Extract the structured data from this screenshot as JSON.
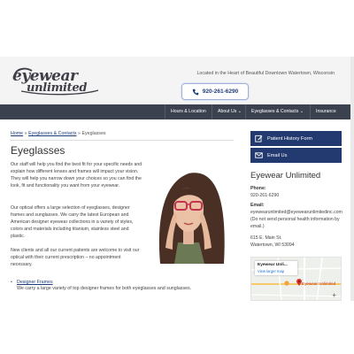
{
  "brand": {
    "logo_top": "eyewear",
    "logo_bottom": "unlimited",
    "tagline": "Located in the Heart of Beautiful Downtown Watertown, Wisconsin"
  },
  "header": {
    "phone": "920-261-6290",
    "phone_icon": "phone-icon"
  },
  "nav": {
    "items": [
      "Hours & Location",
      "About Us",
      "Eyeglasses & Contacts",
      "Insurance"
    ]
  },
  "breadcrumb": {
    "home": "Home",
    "section": "Eyeglasses & Contacts",
    "sep": "»",
    "current": "Eyeglasses"
  },
  "main": {
    "title": "Eyeglasses",
    "para1": "Our staff will help you find the best fit for your specific needs and explain how different lenses and frames will impact your vision. They will help you narrow down your choices so you can find the look, fit and functionality you want from your eyewear.",
    "para2": "Our optical offers a large selection of eyeglasses, designer frames and sunglasses. We carry the latest European and American designer eyewear collections in a variety of styles, colors and materials including titanium, stainless steel and plastic.",
    "para3": "New clients and all our current patients are welcome to visit our optical with their current prescription – no appointment necessary.",
    "list_bullet": "•",
    "list_title": "Designer Frames",
    "list_text": "We carry a large variety of top designer frames for both eyeglasses and sunglasses."
  },
  "sidebar": {
    "buttons": [
      {
        "label": "Patient History Form",
        "icon": "edit-icon"
      },
      {
        "label": "Email Us",
        "icon": "envelope-icon"
      }
    ],
    "title": "Eyewear Unlimited",
    "phone_label": "Phone:",
    "phone": "920-261-6290",
    "email_label": "Email:",
    "email": "eyewearunlimited@eyewearunlimitedinc.com",
    "email_note": "(Do not send personal health information by email.)",
    "address_line1": "615 E. Main St.",
    "address_line2": "Watertown, WI 53094",
    "map": {
      "card_title": "Eyewear Unli...",
      "card_link": "View larger map",
      "pin_label": "Eyewear Unlimited",
      "zoom_in": "+"
    }
  },
  "colors": {
    "nav_bg": "#3c4150",
    "accent": "#223a6f",
    "link": "#1f3c7a"
  }
}
